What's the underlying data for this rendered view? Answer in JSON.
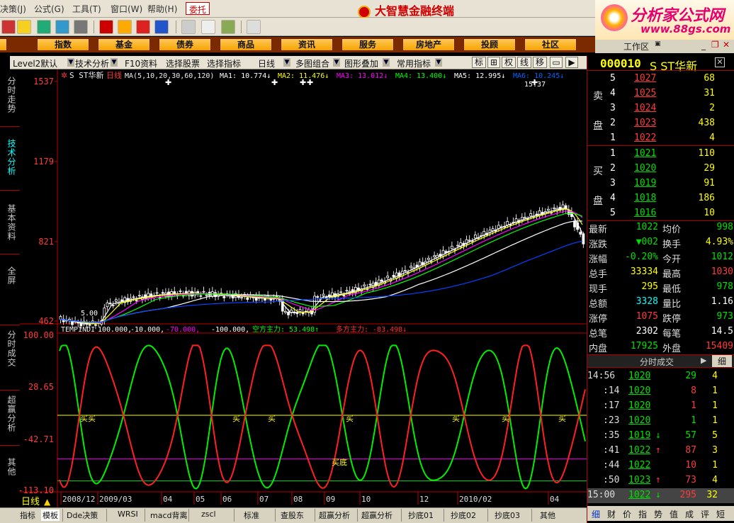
{
  "menu": {
    "items": [
      "决策(J)",
      "公式(G)",
      "工具(T)",
      "窗口(W)",
      "帮助(H)"
    ],
    "entrust": "委托",
    "app_title": "大智慧金融终端"
  },
  "brand_logo": {
    "line1": "分析家公式网",
    "line2": "www.88gs.com"
  },
  "nav": [
    "股",
    "指数",
    "基金",
    "债券",
    "商品",
    "资讯",
    "服务",
    "房地产",
    "投顾",
    "社区"
  ],
  "workzone": "工作区",
  "funcbar": {
    "level2": "Level2默认",
    "tech": "技术分析",
    "f10": "F10资料",
    "pick_stock": "选择股票",
    "pick_index": "选择指标",
    "period": "日线",
    "multi": "多图组合",
    "overlay": "图形叠加",
    "common": "常用指标",
    "btn_biao": "标",
    "btn_quan": "权",
    "btn_xian": "线",
    "btn_yi": "移"
  },
  "left_tabs": [
    "分时走势",
    "技术分析",
    "基本资料",
    "全屏",
    "分时成交",
    "超赢分析",
    "其他"
  ],
  "chart": {
    "stock_label": "S ST华新",
    "period_label": "日线",
    "ma_header": "MA(5,10,20,30,60,120)",
    "ma_values": [
      {
        "label": "MA1: 10.774",
        "color": "#ffffff"
      },
      {
        "label": "MA2: 11.476",
        "color": "#ffff00"
      },
      {
        "label": "MA3: 13.012",
        "color": "#ff00ff"
      },
      {
        "label": "MA4: 13.400",
        "color": "#00ff00"
      },
      {
        "label": "MA5: 12.995",
        "color": "#ffffff"
      },
      {
        "label": "MA6: 10.245",
        "color": "#0066ff"
      }
    ],
    "high_mark": "15.37",
    "low_mark": "5.00",
    "price_ticks": [
      "1537",
      "1179",
      "821",
      "462"
    ],
    "ind_header": "TEMPINDI",
    "ind_values": [
      {
        "label": "100.000,",
        "color": "#ffffff"
      },
      {
        "label": "-10.000,",
        "color": "#ffffff"
      },
      {
        "label": "-70.000,",
        "color": "#ff00ff"
      },
      {
        "label": "-100.000,",
        "color": "#ffffff"
      },
      {
        "label": "空方主力: 53.498↑",
        "color": "#00ff00"
      },
      {
        "label": "多方主力: -83.498↓",
        "color": "#ff3030"
      }
    ],
    "ind_ticks": [
      "100.00",
      "28.65",
      "-42.71",
      "-113.10"
    ],
    "buy_labels": [
      "买买",
      "买",
      "买",
      "买",
      "买",
      "买",
      "买"
    ],
    "bottom_label": "买底",
    "date_labels": [
      "2008/12",
      "2009/03",
      "04",
      "05",
      "06",
      "07",
      "08",
      "09",
      "10",
      "12",
      "2010/02",
      "04"
    ],
    "period_footer": "日线"
  },
  "bottom_tabs": [
    "指标",
    "模板",
    "Dde决策",
    "WRSI",
    "macd背离",
    "zscl",
    "标准",
    "查股东",
    "超赢分析",
    "超赢分析",
    "抄底01",
    "抄底02",
    "抄底03",
    "其他"
  ],
  "quote": {
    "code": "000010",
    "name": "S ST华新",
    "sell_label": [
      "卖",
      "盘"
    ],
    "buy_label": [
      "买",
      "盘"
    ],
    "sells": [
      {
        "lvl": "5",
        "price": "1027",
        "vol": "68"
      },
      {
        "lvl": "4",
        "price": "1025",
        "vol": "31"
      },
      {
        "lvl": "3",
        "price": "1024",
        "vol": "2"
      },
      {
        "lvl": "2",
        "price": "1023",
        "vol": "438"
      },
      {
        "lvl": "1",
        "price": "1022",
        "vol": "4"
      }
    ],
    "buys": [
      {
        "lvl": "1",
        "price": "1021",
        "vol": "110"
      },
      {
        "lvl": "2",
        "price": "1020",
        "vol": "29"
      },
      {
        "lvl": "3",
        "price": "1019",
        "vol": "91"
      },
      {
        "lvl": "4",
        "price": "1018",
        "vol": "186"
      },
      {
        "lvl": "5",
        "price": "1016",
        "vol": "10"
      }
    ],
    "stats": [
      {
        "k1": "最新",
        "v1": "1022",
        "c1": "#00e000",
        "k2": "均价",
        "v2": "998",
        "c2": "#00e000"
      },
      {
        "k1": "涨跌",
        "v1": "▼002",
        "c1": "#00e000",
        "k2": "换手",
        "v2": "4.93%",
        "c2": "#ffff00"
      },
      {
        "k1": "涨幅",
        "v1": "-0.20%",
        "c1": "#00e000",
        "k2": "今开",
        "v2": "1012",
        "c2": "#00e000"
      },
      {
        "k1": "总手",
        "v1": "33334",
        "c1": "#ffff00",
        "k2": "最高",
        "v2": "1030",
        "c2": "#ff3b3b"
      },
      {
        "k1": "现手",
        "v1": "295",
        "c1": "#ffff00",
        "k2": "最低",
        "v2": "978",
        "c2": "#00e000"
      },
      {
        "k1": "总额",
        "v1": "3328",
        "c1": "#00ffff",
        "k2": "量比",
        "v2": "1.16",
        "c2": "#ffffff"
      },
      {
        "k1": "涨停",
        "v1": "1075",
        "c1": "#ff3b3b",
        "k2": "跌停",
        "v2": "973",
        "c2": "#00e000"
      },
      {
        "k1": "总笔",
        "v1": "2302",
        "c1": "#ffffff",
        "k2": "每笔",
        "v2": "14.5",
        "c2": "#ffffff"
      },
      {
        "k1": "内盘",
        "v1": "17925",
        "c1": "#00e000",
        "k2": "外盘",
        "v2": "15409",
        "c2": "#ff3b3b"
      }
    ],
    "ticks_header": "分时成交",
    "ticks_btn": "细",
    "ticks": [
      {
        "t": "14:56",
        "p": "1020",
        "v": "29",
        "n": "4",
        "vc": "#00e000",
        "ar": ""
      },
      {
        "t": ":14",
        "p": "1020",
        "v": "8",
        "n": "1",
        "vc": "#ff3b3b",
        "ar": ""
      },
      {
        "t": ":17",
        "p": "1020",
        "v": "1",
        "n": "1",
        "vc": "#ff3b3b",
        "ar": ""
      },
      {
        "t": ":23",
        "p": "1020",
        "v": "1",
        "n": "1",
        "vc": "#00e000",
        "ar": ""
      },
      {
        "t": ":35",
        "p": "1019",
        "v": "57",
        "n": "5",
        "vc": "#00e000",
        "ar": "↓"
      },
      {
        "t": ":41",
        "p": "1022",
        "v": "87",
        "n": "3",
        "vc": "#ff3b3b",
        "ar": "↑"
      },
      {
        "t": ":44",
        "p": "1022",
        "v": "10",
        "n": "1",
        "vc": "#ff3b3b",
        "ar": ""
      },
      {
        "t": ":50",
        "p": "1023",
        "v": "73",
        "n": "4",
        "vc": "#ff3b3b",
        "ar": "↑"
      },
      {
        "t": "15:00",
        "p": "1022",
        "v": "295",
        "n": "32",
        "vc": "#ff3b3b",
        "ar": "↓"
      }
    ],
    "bottom_tabs": [
      "细",
      "财",
      "价",
      "指",
      "势",
      "值",
      "成",
      "评",
      "短"
    ]
  }
}
